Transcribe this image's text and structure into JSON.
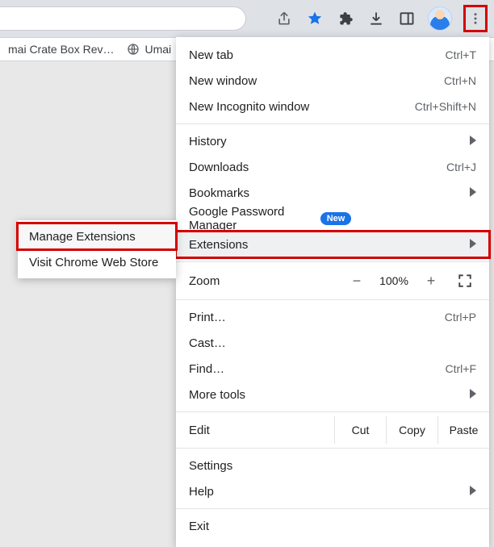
{
  "toolbar": {
    "icons": {
      "share": "share-icon",
      "star": "star-icon",
      "puzzle": "puzzle-icon",
      "download": "download-icon",
      "sidepanel": "sidepanel-icon",
      "avatar": "avatar-icon",
      "kebab": "kebab-icon"
    }
  },
  "bookmarks": {
    "item1": "mai Crate Box Rev…",
    "item2": "Umai"
  },
  "menu": {
    "new_tab": {
      "label": "New tab",
      "shortcut": "Ctrl+T"
    },
    "new_window": {
      "label": "New window",
      "shortcut": "Ctrl+N"
    },
    "new_incognito": {
      "label": "New Incognito window",
      "shortcut": "Ctrl+Shift+N"
    },
    "history": {
      "label": "History"
    },
    "downloads": {
      "label": "Downloads",
      "shortcut": "Ctrl+J"
    },
    "bookmarks": {
      "label": "Bookmarks"
    },
    "password_manager": {
      "label": "Google Password Manager",
      "badge": "New"
    },
    "extensions": {
      "label": "Extensions"
    },
    "zoom": {
      "label": "Zoom",
      "minus": "−",
      "value": "100%",
      "plus": "+"
    },
    "print": {
      "label": "Print…",
      "shortcut": "Ctrl+P"
    },
    "cast": {
      "label": "Cast…"
    },
    "find": {
      "label": "Find…",
      "shortcut": "Ctrl+F"
    },
    "more_tools": {
      "label": "More tools"
    },
    "edit": {
      "label": "Edit",
      "cut": "Cut",
      "copy": "Copy",
      "paste": "Paste"
    },
    "settings": {
      "label": "Settings"
    },
    "help": {
      "label": "Help"
    },
    "exit": {
      "label": "Exit"
    }
  },
  "submenu": {
    "manage": "Manage Extensions",
    "store": "Visit Chrome Web Store"
  }
}
